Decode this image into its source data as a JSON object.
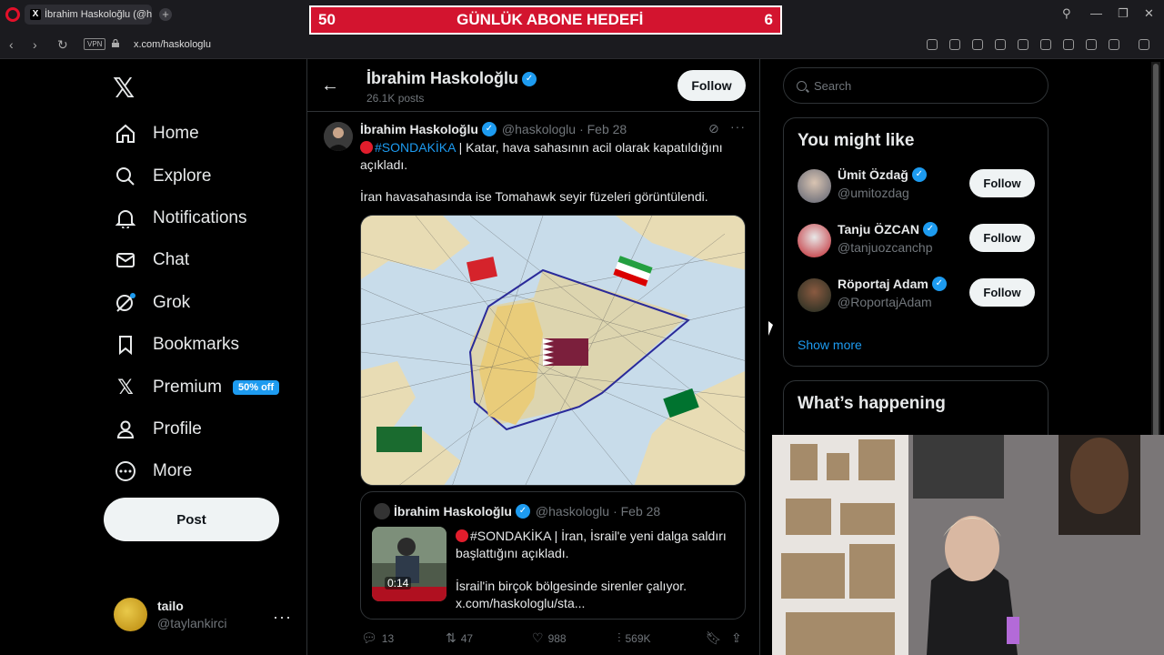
{
  "browser": {
    "tab_title": "İbrahim Haskoloğlu (@has",
    "new_tab": "+",
    "address": "x.com/haskologlu",
    "vpn_label": "VPN"
  },
  "overlay": {
    "left_count": "50",
    "title": "GÜNLÜK ABONE HEDEFİ",
    "right_count": "6"
  },
  "sidebar": {
    "items": [
      {
        "label": "Home",
        "icon": "home-icon"
      },
      {
        "label": "Explore",
        "icon": "search-icon"
      },
      {
        "label": "Notifications",
        "icon": "bell-icon"
      },
      {
        "label": "Chat",
        "icon": "mail-icon"
      },
      {
        "label": "Grok",
        "icon": "grok-icon"
      },
      {
        "label": "Bookmarks",
        "icon": "bookmark-icon"
      },
      {
        "label": "Premium",
        "icon": "x-icon"
      },
      {
        "label": "Profile",
        "icon": "person-icon"
      },
      {
        "label": "More",
        "icon": "more-circle-icon"
      }
    ],
    "premium_badge": "50% off",
    "post_label": "Post",
    "account": {
      "name": "tailo",
      "handle": "@taylankirci"
    }
  },
  "profile_header": {
    "name": "İbrahim Haskoloğlu",
    "posts": "26.1K posts",
    "follow_label": "Follow"
  },
  "tweet": {
    "author": "İbrahim Haskoloğlu",
    "handle": "@haskologlu",
    "date": "· Feb 28",
    "hashtag": "#SONDAKİKA",
    "text_rest": " | Katar, hava sahasının acil olarak kapatıldığını açıkladı.",
    "text2": "İran havasahasında ise Tomahawk seyir füzeleri görüntülendi.",
    "stats": {
      "replies": "13",
      "reposts": "47",
      "likes": "988",
      "views": "569K"
    }
  },
  "quote": {
    "author": "İbrahim Haskoloğlu",
    "handle": "@haskologlu",
    "date": "· Feb 28",
    "hashtag": "#SONDAKİKA",
    "text_rest": " | İran, İsrail'e yeni dalga saldırı başlattığını açıkladı.",
    "text2": "İsrail'in birçok bölgesinde sirenler çalıyor.",
    "link": "x.com/haskologlu/sta...",
    "video_duration": "0:14"
  },
  "right": {
    "search_placeholder": "Search",
    "wtf_title": "You might like",
    "suggestions": [
      {
        "name": "Ümit Özdağ",
        "handle": "@umitozdag",
        "follow": "Follow"
      },
      {
        "name": "Tanju ÖZCAN",
        "handle": "@tanjuozcanchp",
        "follow": "Follow"
      },
      {
        "name": "Röportaj Adam",
        "handle": "@RoportajAdam",
        "follow": "Follow"
      }
    ],
    "show_more": "Show more",
    "happening_title": "What’s happening"
  },
  "colors": {
    "accent": "#1d9bf0",
    "banner": "#d3142f",
    "background": "#000000"
  }
}
